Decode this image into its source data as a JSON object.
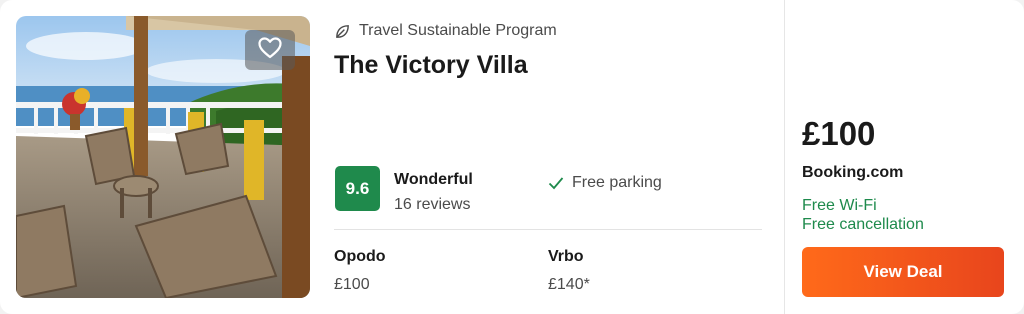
{
  "listing": {
    "eco_label": "Travel Sustainable Program",
    "hotel_name": "The Victory Villa",
    "rating": {
      "score": "9.6",
      "word": "Wonderful",
      "reviews": "16 reviews"
    },
    "amenities": [
      {
        "label": "Free parking",
        "icon": "check-icon"
      }
    ],
    "other_prices": [
      {
        "provider": "Opodo",
        "price": "£100"
      },
      {
        "provider": "Vrbo",
        "price": "£140*"
      }
    ]
  },
  "deal": {
    "price": "£100",
    "provider": "Booking.com",
    "perks": [
      "Free Wi-Fi",
      "Free cancellation"
    ],
    "button_label": "View Deal"
  },
  "colors": {
    "rating_badge": "#1f8a4c",
    "perk_text": "#1e8a4c",
    "deal_button_start": "#ff6a1a",
    "deal_button_end": "#e8451c"
  },
  "icons": {
    "favorite": "heart-icon",
    "eco": "leaf-icon",
    "amenity": "check-icon"
  }
}
